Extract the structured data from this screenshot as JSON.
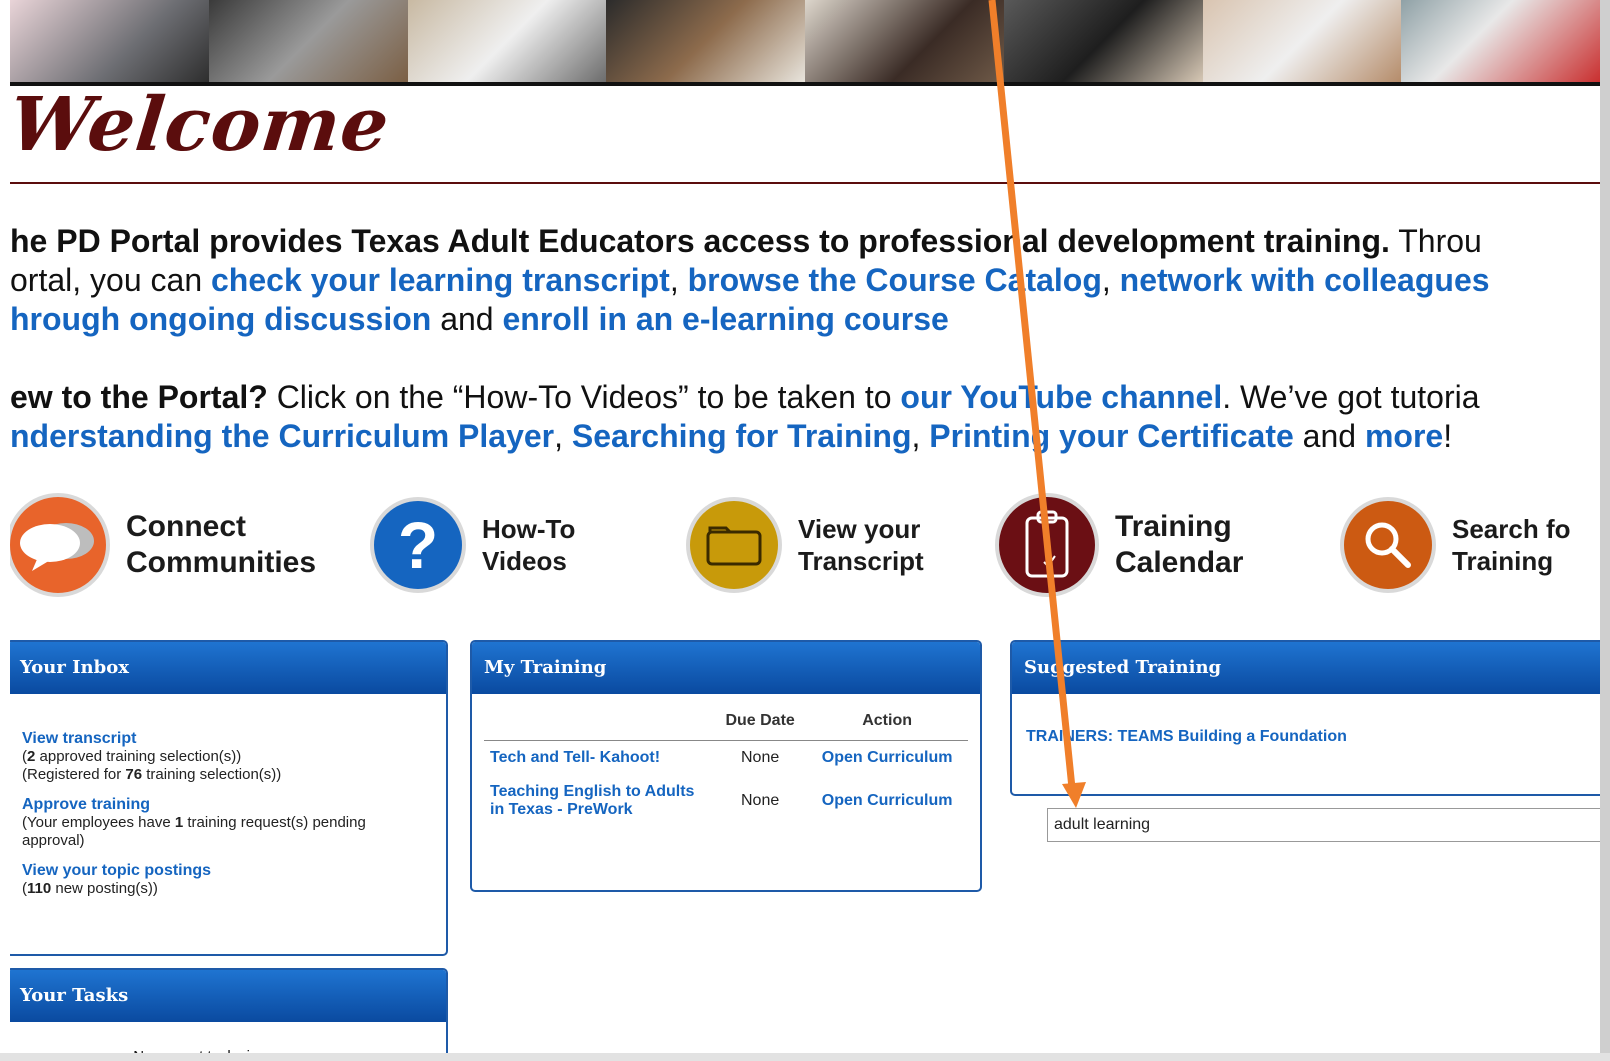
{
  "welcome": {
    "heading": "Welcome"
  },
  "intro": {
    "p1_bold": "he PD Portal provides Texas Adult Educators access to professional development training.",
    "p1_cont1": " Throu",
    "p1_line2_start": "ortal, you can ",
    "link_transcript": "check your learning transcript",
    "sep1": ", ",
    "link_catalog": "browse the Course Catalog",
    "sep2": ", ",
    "link_network": "network with colleagues",
    "link_discussion": "hrough ongoing discussion",
    "and": " and ",
    "link_enroll": "enroll in an e-learning course",
    "new_bold": "ew to the Portal?",
    "new_text": " Click on the “How-To Videos” to be taken to ",
    "link_youtube": "our YouTube channel",
    "new_text2": ". We’ve got tutoria",
    "link_curriculum": "nderstanding the Curriculum Player",
    "link_searching": "Searching for Training",
    "link_printing": "Printing your Certificate",
    "and2": " and ",
    "link_more": "more",
    "excl": "!"
  },
  "icons": [
    {
      "label1": "Connect",
      "label2": "Communities",
      "icon": "chat-bubbles-icon",
      "color": "#e8642b"
    },
    {
      "label1": "How-To",
      "label2": "Videos",
      "icon": "question-icon",
      "color": "#1565c0"
    },
    {
      "label1": "View your",
      "label2": "Transcript",
      "icon": "folder-icon",
      "color": "#c89a0a"
    },
    {
      "label1": "Training",
      "label2": "Calendar",
      "icon": "clipboard-icon",
      "color": "#6b0f14"
    },
    {
      "label1": "Search fo",
      "label2": "Training",
      "icon": "magnifier-icon",
      "color": "#cc5a12"
    }
  ],
  "inbox": {
    "title": "Your Inbox",
    "view_transcript": "View transcript",
    "approved_count": "2",
    "approved_text": " approved training selection(s))",
    "registered_pre": "(Registered for ",
    "registered_count": "76",
    "registered_text": " training selection(s))",
    "approve_training": "Approve training",
    "pending_pre": "(Your employees have ",
    "pending_count": "1",
    "pending_text": " training request(s) pending approval)",
    "topic_postings": "View your topic postings",
    "postings_count": "110",
    "postings_text": " new posting(s))"
  },
  "tasks": {
    "title": "Your Tasks",
    "empty": "No current tasks in progress"
  },
  "my_training": {
    "title": "My Training",
    "col_due": "Due Date",
    "col_action": "Action",
    "rows": [
      {
        "title": "Tech and Tell- Kahoot!",
        "due": "None",
        "action": "Open Curriculum"
      },
      {
        "title": "Teaching English to Adults in Texas - PreWork",
        "due": "None",
        "action": "Open Curriculum"
      }
    ]
  },
  "suggested": {
    "title": "Suggested Training",
    "item": "TRAINERS: TEAMS Building a Foundation",
    "search_value": "adult learning"
  },
  "colors": {
    "panel_head": "#0a4aa0",
    "link": "#1565c0",
    "welcome": "#5b0d0d",
    "arrow": "#f07f2a"
  }
}
